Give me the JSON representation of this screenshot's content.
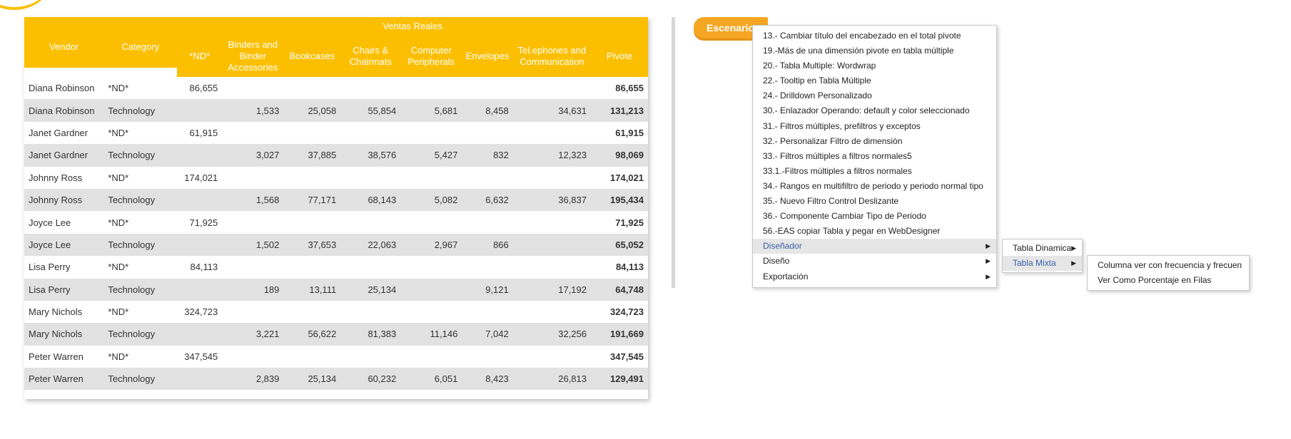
{
  "table": {
    "super_header": "Ventas Reales",
    "columns": [
      "Vendor",
      "Category",
      "*ND*",
      "Binders and Binder Accessories",
      "Bookcases",
      "Chairs & Chairmats",
      "Computer Peripherals",
      "Envelopes",
      "Tel.ephones and Communication",
      "Pivote"
    ],
    "rows": [
      [
        "Diana Robinson",
        "*ND*",
        "86,655",
        "",
        "",
        "",
        "",
        "",
        "",
        "86,655"
      ],
      [
        "Diana Robinson",
        "Technology",
        "",
        "1,533",
        "25,058",
        "55,854",
        "5,681",
        "8,458",
        "34,631",
        "131,213"
      ],
      [
        "Janet Gardner",
        "*ND*",
        "61,915",
        "",
        "",
        "",
        "",
        "",
        "",
        "61,915"
      ],
      [
        "Janet Gardner",
        "Technology",
        "",
        "3,027",
        "37,885",
        "38,576",
        "5,427",
        "832",
        "12,323",
        "98,069"
      ],
      [
        "Johnny Ross",
        "*ND*",
        "174,021",
        "",
        "",
        "",
        "",
        "",
        "",
        "174,021"
      ],
      [
        "Johnny Ross",
        "Technology",
        "",
        "1,568",
        "77,171",
        "68,143",
        "5,082",
        "6,632",
        "36,837",
        "195,434"
      ],
      [
        "Joyce Lee",
        "*ND*",
        "71,925",
        "",
        "",
        "",
        "",
        "",
        "",
        "71,925"
      ],
      [
        "Joyce Lee",
        "Technology",
        "",
        "1,502",
        "37,653",
        "22,063",
        "2,967",
        "866",
        "",
        "65,052"
      ],
      [
        "Lisa Perry",
        "*ND*",
        "84,113",
        "",
        "",
        "",
        "",
        "",
        "",
        "84,113"
      ],
      [
        "Lisa Perry",
        "Technology",
        "",
        "189",
        "13,111",
        "25,134",
        "",
        "9,121",
        "17,192",
        "64,748"
      ],
      [
        "Mary Nichols",
        "*ND*",
        "324,723",
        "",
        "",
        "",
        "",
        "",
        "",
        "324,723"
      ],
      [
        "Mary Nichols",
        "Technology",
        "",
        "3,221",
        "56,622",
        "81,383",
        "11,146",
        "7,042",
        "32,256",
        "191,669"
      ],
      [
        "Peter Warren",
        "*ND*",
        "347,545",
        "",
        "",
        "",
        "",
        "",
        "",
        "347,545"
      ],
      [
        "Peter Warren",
        "Technology",
        "",
        "2,839",
        "25,134",
        "60,232",
        "6,051",
        "8,423",
        "26,813",
        "129,491"
      ]
    ]
  },
  "escenarios_button": "Escenarios",
  "menu_main": [
    {
      "label": "13.- Cambiar título del encabezado en el total pivote"
    },
    {
      "label": "19.-Más de una dimensión pivote en tabla múltiple"
    },
    {
      "label": "20.- Tabla Multiple: Wordwrap"
    },
    {
      "label": "22.- Tooltip en Tabla Múltiple"
    },
    {
      "label": "24.- Drilldown Personalizado"
    },
    {
      "label": "30.- Enlazador Operando: default y color seleccionado"
    },
    {
      "label": "31.- Filtros múltiples, prefiltros y exceptos"
    },
    {
      "label": "32.- Personalizar Filtro de dimensión"
    },
    {
      "label": "33.- Filtros múltiples a filtros normales5"
    },
    {
      "label": "33.1.-Filtros múltiples a filtros normales"
    },
    {
      "label": "34.- Rangos en multifiltro de periodo y periodo normal tipo"
    },
    {
      "label": "35.- Nuevo Filtro Control Deslizante"
    },
    {
      "label": "36.- Componente Cambiar Tipo de Periodo"
    },
    {
      "label": "56.-EAS copiar Tabla y pegar en WebDesigner"
    },
    {
      "label": "Diseñador",
      "submenu": true,
      "active": true
    },
    {
      "label": "Diseño",
      "submenu": true
    },
    {
      "label": "Exportación",
      "submenu": true
    }
  ],
  "menu_disenador": [
    {
      "label": "Tabla Dinamica",
      "submenu": true
    },
    {
      "label": "Tabla Mixta",
      "submenu": true,
      "active": true
    }
  ],
  "menu_tabla_mixta": [
    {
      "label": "Columna ver con frecuencia y frecuen"
    },
    {
      "label": "Ver Como Porcentaje en Filas"
    }
  ],
  "colors": {
    "header": "#FCBF00",
    "button": "#F5A623",
    "active_text": "#3a5fa8"
  },
  "icons": {
    "submenu_arrow": "▶"
  }
}
